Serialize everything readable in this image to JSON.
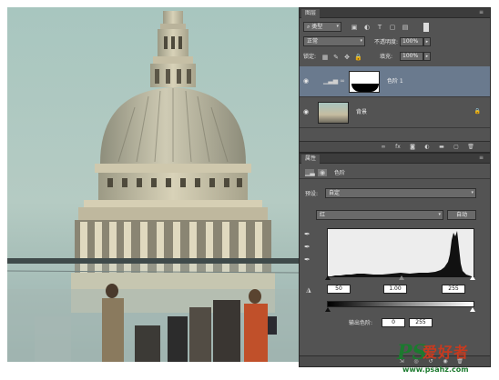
{
  "layers_panel": {
    "tab": "图层",
    "filter_kind": "类型",
    "blend_mode": "正常",
    "opacity_label": "不透明度:",
    "opacity_value": "100%",
    "lock_label": "锁定:",
    "fill_label": "填充:",
    "fill_value": "100%",
    "layers": [
      {
        "name": "色阶 1",
        "selected": true
      },
      {
        "name": "背景",
        "selected": false
      }
    ]
  },
  "properties_panel": {
    "tab": "属性",
    "title": "色阶",
    "preset_label": "预设:",
    "preset_value": "自定",
    "channel_value": "红",
    "auto_button": "自动",
    "input_black": "50",
    "input_gamma": "1.00",
    "input_white": "255",
    "output_label": "输出色阶:",
    "output_black": "0",
    "output_white": "255"
  },
  "watermark": {
    "ps": "PS",
    "cn": "爱好者",
    "url": "www.psahz.com"
  },
  "colors": {
    "panel_bg": "#535353",
    "selected_layer": "#6a7a8e",
    "watermark_green": "#1b7a2e",
    "watermark_red": "#c73a1f"
  }
}
